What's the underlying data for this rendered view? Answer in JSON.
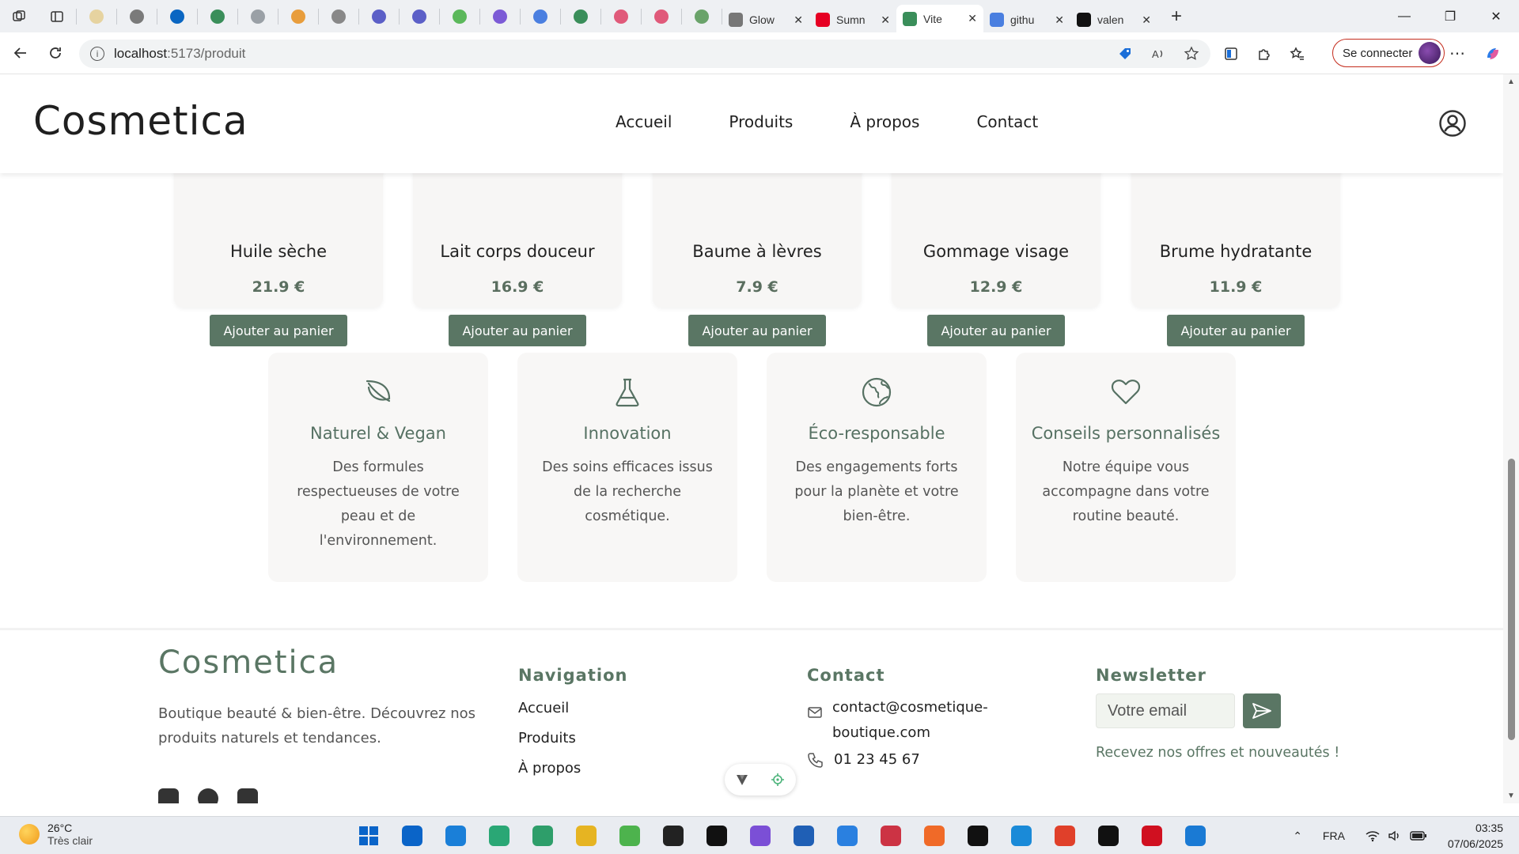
{
  "browser": {
    "pinned_tab_colors": [
      "#e6d3a0",
      "#7a7a7a",
      "#0a66c2",
      "#3a8e5a",
      "#9aa0a6",
      "#e89d3c",
      "#888888",
      "#5b5fc7",
      "#5b5fc7",
      "#5bb85b",
      "#7c5bd6",
      "#4a7fe0",
      "#3a8e5a",
      "#e05a7a",
      "#e05a7a",
      "#6aa36a"
    ],
    "tabs": [
      {
        "title": "Glow",
        "icon": "g-icon",
        "color": "#777777"
      },
      {
        "title": "Sumn",
        "icon": "pinterest-icon",
        "color": "#e60023"
      },
      {
        "title": "Vite",
        "icon": "vite-icon",
        "color": "#3a8e5a",
        "active": true
      },
      {
        "title": "githu",
        "icon": "search-icon",
        "color": "#4a7fe0"
      },
      {
        "title": "valen",
        "icon": "github-icon",
        "color": "#111111"
      }
    ],
    "new_tab": "+",
    "url_host": "localhost",
    "url_rest": ":5173/produit",
    "signin_label": "Se connecter"
  },
  "site": {
    "logo": "Cosmetica",
    "nav": [
      "Accueil",
      "Produits",
      "À propos",
      "Contact"
    ],
    "accent": "#5a7664",
    "products": [
      {
        "name": "Huile sèche",
        "price": "21.9 €",
        "button": "Ajouter au panier"
      },
      {
        "name": "Lait corps douceur",
        "price": "16.9 €",
        "button": "Ajouter au panier"
      },
      {
        "name": "Baume à lèvres",
        "price": "7.9 €",
        "button": "Ajouter au panier"
      },
      {
        "name": "Gommage visage",
        "price": "12.9 €",
        "button": "Ajouter au panier"
      },
      {
        "name": "Brume hydratante",
        "price": "11.9 €",
        "button": "Ajouter au panier"
      }
    ],
    "features": [
      {
        "icon": "leaf-icon",
        "title": "Naturel & Vegan",
        "desc": "Des formules respectueuses de votre peau et de l'environnement."
      },
      {
        "icon": "flask-icon",
        "title": "Innovation",
        "desc": "Des soins efficaces issus de la recherche cosmétique."
      },
      {
        "icon": "globe-icon",
        "title": "Éco-responsable",
        "desc": "Des engagements forts pour la planète et votre bien-être."
      },
      {
        "icon": "heart-icon",
        "title": "Conseils personnalisés",
        "desc": "Notre équipe vous accompagne dans votre routine beauté."
      }
    ],
    "footer": {
      "logo": "Cosmetica",
      "tagline": "Boutique beauté & bien-être. Découvrez nos produits naturels et tendances.",
      "nav_title": "Navigation",
      "nav_links": [
        "Accueil",
        "Produits",
        "À propos"
      ],
      "contact_title": "Contact",
      "email": "contact@cosmetique-boutique.com",
      "phone": "01 23 45 67",
      "newsletter_title": "Newsletter",
      "newsletter_placeholder": "Votre email",
      "newsletter_note": "Recevez nos offres et nouveautés !"
    }
  },
  "taskbar": {
    "temperature": "26°C",
    "weather_text": "Très clair",
    "app_colors": [
      "#0a64c8",
      "#1a7fd8",
      "#2aa775",
      "#2e9e6a",
      "#e6b422",
      "#4db34d",
      "#222222",
      "#111111",
      "#7b4fd6",
      "#1f5fb5",
      "#2a80e0",
      "#cc3344",
      "#f06a28",
      "#111111",
      "#1a8ad8",
      "#e0402a",
      "#111111",
      "#d01020",
      "#1a7ad4"
    ],
    "language": "FRA",
    "time": "03:35",
    "date": "07/06/2025"
  }
}
